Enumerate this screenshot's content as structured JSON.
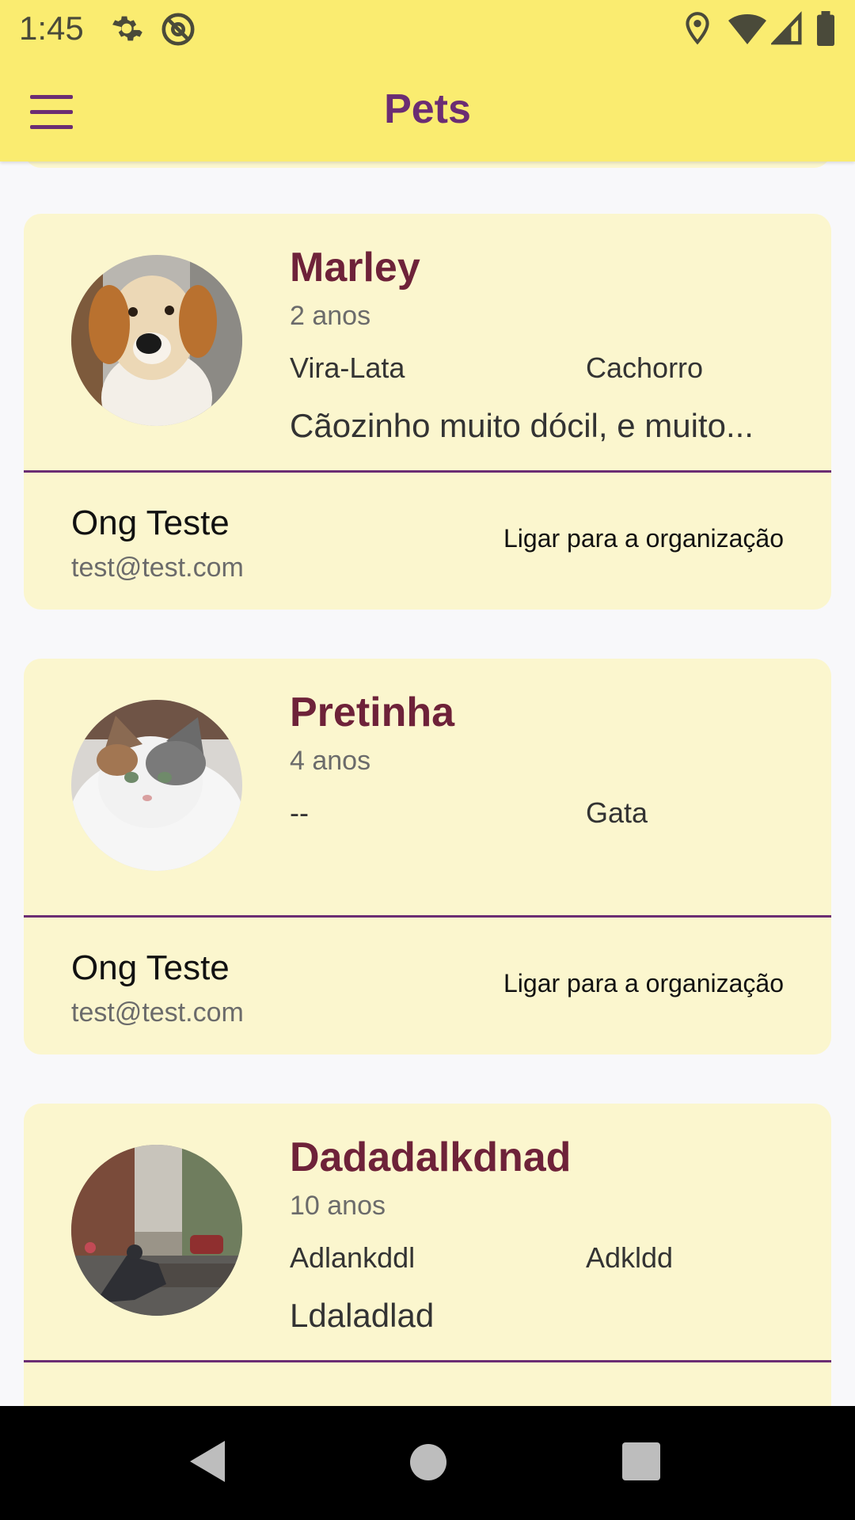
{
  "status_bar": {
    "time": "1:45",
    "icons": [
      "gear-icon",
      "at-icon",
      "location-icon",
      "wifi-icon",
      "signal-icon",
      "battery-icon"
    ]
  },
  "app_bar": {
    "title": "Pets",
    "menu_icon": "hamburger-menu-icon"
  },
  "colors": {
    "app_bar_bg": "#FAEC70",
    "accent": "#6B2D73",
    "pet_name": "#6E2239",
    "card_bg": "#FBF6CE",
    "page_bg": "#F8F8FA"
  },
  "pets": [
    {
      "name": "Marley",
      "age": "2 anos",
      "breed": "Vira-Lata",
      "species": "Cachorro",
      "description": "Cãozinho muito dócil, e muito...",
      "photo": "dog-photo",
      "org_name": "Ong Teste",
      "org_email": "test@test.com",
      "call_label": "Ligar para a organização"
    },
    {
      "name": "Pretinha",
      "age": "4 anos",
      "breed": "--",
      "species": "Gata",
      "description": "",
      "photo": "cat-photo",
      "org_name": "Ong Teste",
      "org_email": "test@test.com",
      "call_label": "Ligar para a organização"
    },
    {
      "name": "Dadadalkdnad",
      "age": "10 anos",
      "breed": "Adlankddl",
      "species": "Adkldd",
      "description": "Ldaladlad",
      "photo": "street-statue-photo",
      "org_name": "",
      "org_email": "",
      "call_label": ""
    }
  ],
  "nav_bar": {
    "back": "back-icon",
    "home": "home-icon",
    "recents": "recents-icon"
  }
}
